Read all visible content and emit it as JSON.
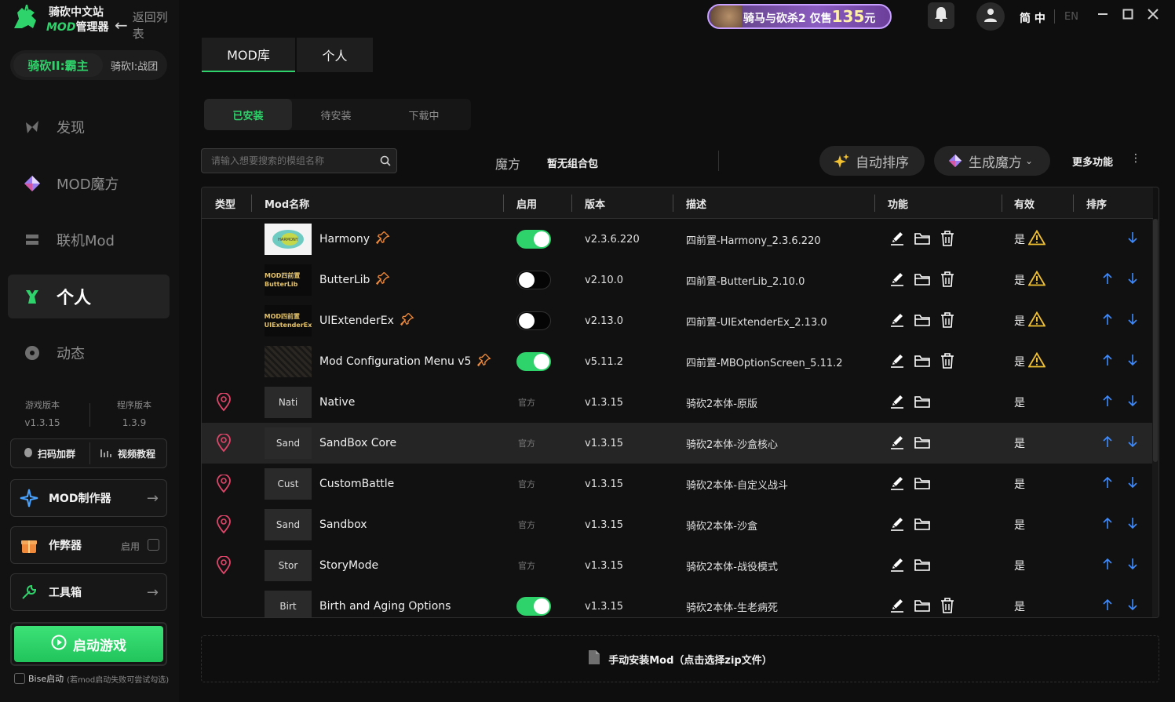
{
  "app": {
    "title_line1": "骑砍中文站",
    "title_line2_mod": "MOD",
    "title_line2_rest": "管理器",
    "back": "返回列表"
  },
  "game_switch": {
    "active": "骑砍II:霸主",
    "other": "骑砍I:战团"
  },
  "nav": [
    {
      "label": "发现",
      "icon": "compass-icon"
    },
    {
      "label": "MOD魔方",
      "icon": "diamond-icon"
    },
    {
      "label": "联机Mod",
      "icon": "server-icon"
    },
    {
      "label": "个人",
      "icon": "person-icon",
      "active": true
    },
    {
      "label": "动态",
      "icon": "chat-icon"
    }
  ],
  "versions": {
    "game_label": "游戏版本",
    "game_value": "v1.3.15",
    "app_label": "程序版本",
    "app_value": "1.3.9"
  },
  "side_pill": {
    "left": "扫码加群",
    "right": "视频教程"
  },
  "side_cards": {
    "mod_maker": "MOD制作器",
    "cheat": "作弊器",
    "cheat_enable": "启用",
    "toolbox": "工具箱"
  },
  "launch": "启动游戏",
  "bise": {
    "label": "Bise启动",
    "hint": "(若mod启动失败可尝试勾选)"
  },
  "topbar": {
    "banner_text": "骑马与砍杀2 仅售",
    "banner_price": "135",
    "banner_unit": "元",
    "lang_zh": "简 中",
    "lang_en": "EN"
  },
  "main_tabs": [
    {
      "label": "MOD库",
      "active": true
    },
    {
      "label": "个人",
      "active": false
    }
  ],
  "sub_tabs": [
    {
      "label": "已安装",
      "active": true
    },
    {
      "label": "待安装",
      "active": false
    },
    {
      "label": "下载中",
      "active": false
    }
  ],
  "toolbar": {
    "search_placeholder": "请输入想要搜索的模组名称",
    "magic_label": "魔方",
    "magic_value": "暂无组合包",
    "auto_sort": "自动排序",
    "gen_magic": "生成魔方",
    "more": "更多功能"
  },
  "table": {
    "headers": [
      "类型",
      "Mod名称",
      "启用",
      "版本",
      "描述",
      "功能",
      "有效",
      "排序"
    ],
    "rows": [
      {
        "name": "Harmony",
        "thumb": "",
        "thumb_kind": "harmony",
        "enabled": "on",
        "official": "",
        "version": "v2.3.6.220",
        "desc": "四前置-Harmony_2.3.6.220",
        "can_delete": true,
        "valid": "是",
        "warn": true,
        "up": false,
        "down": true,
        "pinned": false,
        "starred": true
      },
      {
        "name": "ButterLib",
        "thumb": "MOD四前置 ButterLib",
        "thumb_kind": "blk",
        "enabled": "off",
        "official": "",
        "version": "v2.10.0",
        "desc": "四前置-ButterLib_2.10.0",
        "can_delete": true,
        "valid": "是",
        "warn": true,
        "up": true,
        "down": true,
        "pinned": false,
        "starred": true
      },
      {
        "name": "UIExtenderEx",
        "thumb": "MOD四前置 UIExtenderEx",
        "thumb_kind": "blk",
        "enabled": "off",
        "official": "",
        "version": "v2.13.0",
        "desc": "四前置-UIExtenderEx_2.13.0",
        "can_delete": true,
        "valid": "是",
        "warn": true,
        "up": true,
        "down": true,
        "pinned": false,
        "starred": true
      },
      {
        "name": "Mod Configuration Menu v5",
        "thumb": "",
        "thumb_kind": "mcm",
        "enabled": "on",
        "official": "",
        "version": "v5.11.2",
        "desc": "四前置-MBOptionScreen_5.11.2",
        "can_delete": true,
        "valid": "是",
        "warn": true,
        "up": true,
        "down": true,
        "pinned": false,
        "starred": true
      },
      {
        "name": "Native",
        "thumb": "Nati",
        "thumb_kind": "plain",
        "enabled": "",
        "official": "官方",
        "version": "v1.3.15",
        "desc": "骑砍2本体-原版",
        "can_delete": false,
        "valid": "是",
        "warn": false,
        "up": true,
        "down": true,
        "pinned": true,
        "starred": false
      },
      {
        "name": "SandBox Core",
        "thumb": "Sand",
        "thumb_kind": "plain",
        "enabled": "",
        "official": "官方",
        "version": "v1.3.15",
        "desc": "骑砍2本体-沙盒核心",
        "can_delete": false,
        "valid": "是",
        "warn": false,
        "up": true,
        "down": true,
        "pinned": true,
        "starred": false,
        "highlight": true
      },
      {
        "name": "CustomBattle",
        "thumb": "Cust",
        "thumb_kind": "plain",
        "enabled": "",
        "official": "官方",
        "version": "v1.3.15",
        "desc": "骑砍2本体-自定义战斗",
        "can_delete": false,
        "valid": "是",
        "warn": false,
        "up": true,
        "down": true,
        "pinned": true,
        "starred": false
      },
      {
        "name": "Sandbox",
        "thumb": "Sand",
        "thumb_kind": "plain",
        "enabled": "",
        "official": "官方",
        "version": "v1.3.15",
        "desc": "骑砍2本体-沙盒",
        "can_delete": false,
        "valid": "是",
        "warn": false,
        "up": true,
        "down": true,
        "pinned": true,
        "starred": false
      },
      {
        "name": "StoryMode",
        "thumb": "Stor",
        "thumb_kind": "plain",
        "enabled": "",
        "official": "官方",
        "version": "v1.3.15",
        "desc": "骑砍2本体-战役模式",
        "can_delete": false,
        "valid": "是",
        "warn": false,
        "up": true,
        "down": true,
        "pinned": true,
        "starred": false
      },
      {
        "name": "Birth and Aging Options",
        "thumb": "Birt",
        "thumb_kind": "plain",
        "enabled": "on",
        "official": "",
        "version": "v1.3.15",
        "desc": "骑砍2本体-生老病死",
        "can_delete": true,
        "valid": "是",
        "warn": false,
        "up": true,
        "down": true,
        "pinned": false,
        "starred": false
      }
    ]
  },
  "install_bar": "手动安装Mod（点击选择zip文件）",
  "colors": {
    "accent": "#2fd36b",
    "warn": "#f2c232",
    "arrow": "#3d8bff",
    "pin": "#e0456a",
    "star": "#f08a3a"
  }
}
